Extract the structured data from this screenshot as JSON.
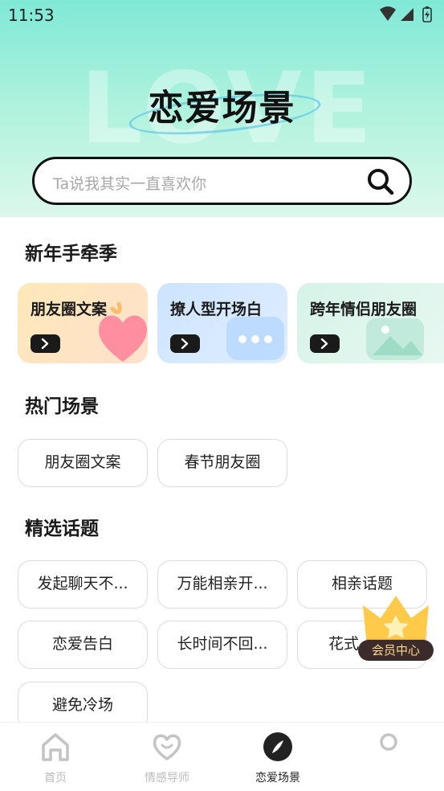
{
  "status_bar": {
    "time": "11:53"
  },
  "hero": {
    "background_word": "LOVE",
    "title": "恋爱场景"
  },
  "search": {
    "placeholder": "Ta说我其实一直喜欢你"
  },
  "sections": {
    "new_year": {
      "title": "新年手牵季",
      "cards": [
        {
          "label": "朋友圈文案",
          "icon": "heart-icon"
        },
        {
          "label": "撩人型开场白",
          "icon": "chat-bubble-icon"
        },
        {
          "label": "跨年情侣朋友圈",
          "icon": "image-icon"
        }
      ]
    },
    "hot": {
      "title": "热门场景",
      "chips": [
        "朋友圈文案",
        "春节朋友圈"
      ]
    },
    "topics": {
      "title": "精选话题",
      "chips": [
        "发起聊天不...",
        "万能相亲开...",
        "相亲话题",
        "恋爱告白",
        "长时间不回...",
        "花式",
        "避免冷场"
      ]
    }
  },
  "vip": {
    "label": "会员中心",
    "icon": "crown-icon"
  },
  "tabbar": {
    "tabs": [
      {
        "label": "首页",
        "icon": "home-icon"
      },
      {
        "label": "情感导师",
        "icon": "heart-smile-icon"
      },
      {
        "label": "恋爱场景",
        "icon": "compass-icon"
      },
      {
        "label": "",
        "icon": "profile-icon"
      }
    ],
    "active_index": 2
  },
  "colors": {
    "accent": "#1a1a1a",
    "hero_top": "#7fe9d6",
    "inactive_tab": "#bcbcbc"
  }
}
